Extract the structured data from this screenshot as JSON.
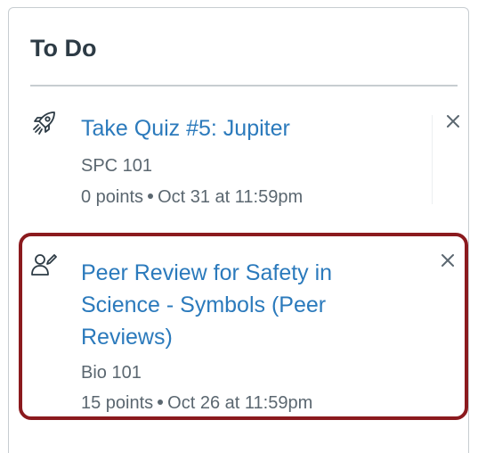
{
  "todo": {
    "title": "To Do",
    "items": [
      {
        "icon": "quiz-rocket-icon",
        "link": "Take Quiz #5: Jupiter",
        "course": "SPC 101",
        "points": "0 points",
        "due": "Oct 31 at 11:59pm"
      },
      {
        "icon": "peer-review-icon",
        "link": "Peer Review for Safety in Science - Symbols (Peer Reviews)",
        "course": "Bio 101",
        "points": "15 points",
        "due": "Oct 26 at 11:59pm"
      }
    ]
  },
  "colors": {
    "link": "#2b7abc",
    "heading": "#2d3b45",
    "meta": "#5b6770",
    "highlight_border": "#8b1a1e",
    "divider": "#c7cdd1"
  }
}
